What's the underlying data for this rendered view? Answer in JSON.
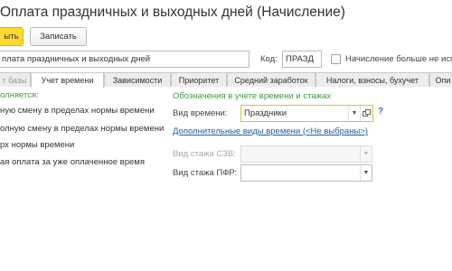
{
  "window": {
    "title": "Оплата праздничных и выходных дней (Начисление)"
  },
  "toolbar": {
    "save_close_label": "ыть",
    "save_label": "Записать"
  },
  "form": {
    "name_value": "плата праздничных и выходных дней",
    "code_label": "Код:",
    "code_value": "ПРАЗД",
    "overpay_checkbox_label": "Начисление больше не исп"
  },
  "tabs": [
    {
      "label": "т базы"
    },
    {
      "label": "Учет времени"
    },
    {
      "label": "Зависимости"
    },
    {
      "label": "Приоритет"
    },
    {
      "label": "Средний заработок"
    },
    {
      "label": "Налоги, взносы, бухучет"
    },
    {
      "label": "Опи"
    }
  ],
  "left_panel": {
    "heading": "олняется:",
    "options": [
      "ную смену в пределах нормы времени",
      "олную смену в пределах нормы времени",
      "рх нормы времени",
      "ая оплата за уже оплаченное время"
    ]
  },
  "time_tracking": {
    "heading": "Обозначения в учете времени и стажах",
    "time_type_label": "Вид времени:",
    "time_type_value": "Праздники",
    "help_label": "?",
    "additional_link": "Дополнительные виды времени (<Не выбраны>)",
    "szv_label": "Вид стажа СЗВ:",
    "pfr_label": "Вид стажа ПФР:"
  }
}
